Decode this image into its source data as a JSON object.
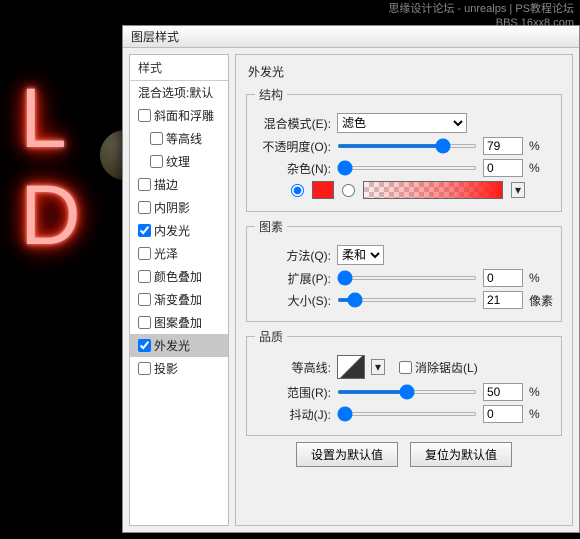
{
  "watermark": {
    "line1": "思缘设计论坛 - unrealps | PS教程论坛",
    "line2": "BBS.16xx8.com"
  },
  "neon": {
    "text": "L\nD"
  },
  "dialog": {
    "title": "图层样式"
  },
  "sidebar": {
    "header": "样式",
    "blend_defaults": "混合选项:默认",
    "items": [
      {
        "label": "斜面和浮雕",
        "checked": false
      },
      {
        "label": "等高线",
        "checked": false,
        "indent": true
      },
      {
        "label": "纹理",
        "checked": false,
        "indent": true
      },
      {
        "label": "描边",
        "checked": false
      },
      {
        "label": "内阴影",
        "checked": false
      },
      {
        "label": "内发光",
        "checked": true
      },
      {
        "label": "光泽",
        "checked": false
      },
      {
        "label": "颜色叠加",
        "checked": false
      },
      {
        "label": "渐变叠加",
        "checked": false
      },
      {
        "label": "图案叠加",
        "checked": false
      },
      {
        "label": "外发光",
        "checked": true,
        "selected": true
      },
      {
        "label": "投影",
        "checked": false
      }
    ]
  },
  "panel": {
    "title": "外发光",
    "structure": {
      "legend": "结构",
      "blend_mode_label": "混合模式(E):",
      "blend_mode_value": "滤色",
      "opacity_label": "不透明度(O):",
      "opacity_value": "79",
      "opacity_unit": "%",
      "noise_label": "杂色(N):",
      "noise_value": "0",
      "noise_unit": "%",
      "color_hex": "#ff1a1a"
    },
    "elements": {
      "legend": "图素",
      "technique_label": "方法(Q):",
      "technique_value": "柔和",
      "spread_label": "扩展(P):",
      "spread_value": "0",
      "spread_unit": "%",
      "size_label": "大小(S):",
      "size_value": "21",
      "size_unit": "像素"
    },
    "quality": {
      "legend": "品质",
      "contour_label": "等高线:",
      "antialias_label": "消除锯齿(L)",
      "range_label": "范围(R):",
      "range_value": "50",
      "range_unit": "%",
      "jitter_label": "抖动(J):",
      "jitter_value": "0",
      "jitter_unit": "%"
    },
    "buttons": {
      "make_default": "设置为默认值",
      "reset_default": "复位为默认值"
    }
  }
}
